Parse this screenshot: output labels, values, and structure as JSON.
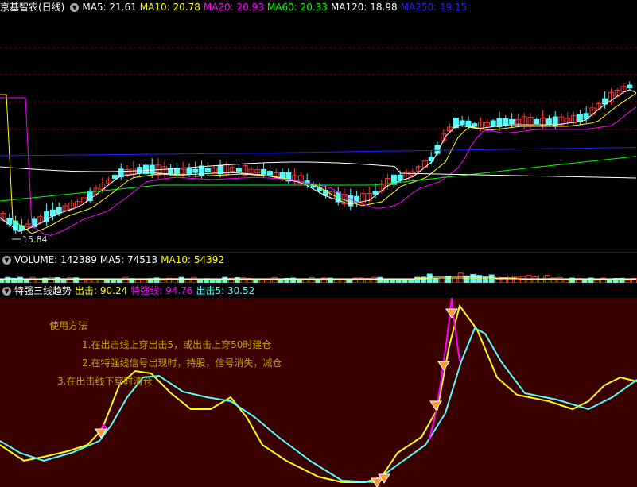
{
  "main": {
    "stock": "京基智农(日线)",
    "ma": [
      {
        "label": "MA5: 21.61",
        "color": "#ffffff"
      },
      {
        "label": "MA10: 20.78",
        "color": "#ffff00"
      },
      {
        "label": "MA20: 20.93",
        "color": "#ff00ff"
      },
      {
        "label": "MA60: 20.33",
        "color": "#00ff00"
      },
      {
        "label": "MA120: 18.98",
        "color": "#ffffff"
      },
      {
        "label": "MA250: 19.15",
        "color": "#2222ff"
      }
    ],
    "low_label": "15.84"
  },
  "volume": {
    "title": "VOLUME: 142389",
    "ma5": "MA5: 74513",
    "ma10": "MA10: 54392"
  },
  "indicator": {
    "name": "特强三线趋势",
    "out_label": "出击: 90.24",
    "strong_label": "特强线: 94.76",
    "out5_label": "出击5: 30.52",
    "notes": {
      "title": "使用方法",
      "l1": "1.在出击线上穿出击5，或出击上穿50时建仓",
      "l2": "2.在特强线信号出现时，持股，信号消失，减仓",
      "l3": "3.在出击线下穿时清仓"
    }
  },
  "colors": {
    "up": "#ff3232",
    "down": "#54fcfc",
    "ma5": "#ffffff",
    "ma10": "#ffff00",
    "ma20": "#ff00ff",
    "ma60": "#00ff00",
    "ma120": "#ffffff",
    "ma250": "#2222ff",
    "ind_bg": "#3a0000"
  }
}
